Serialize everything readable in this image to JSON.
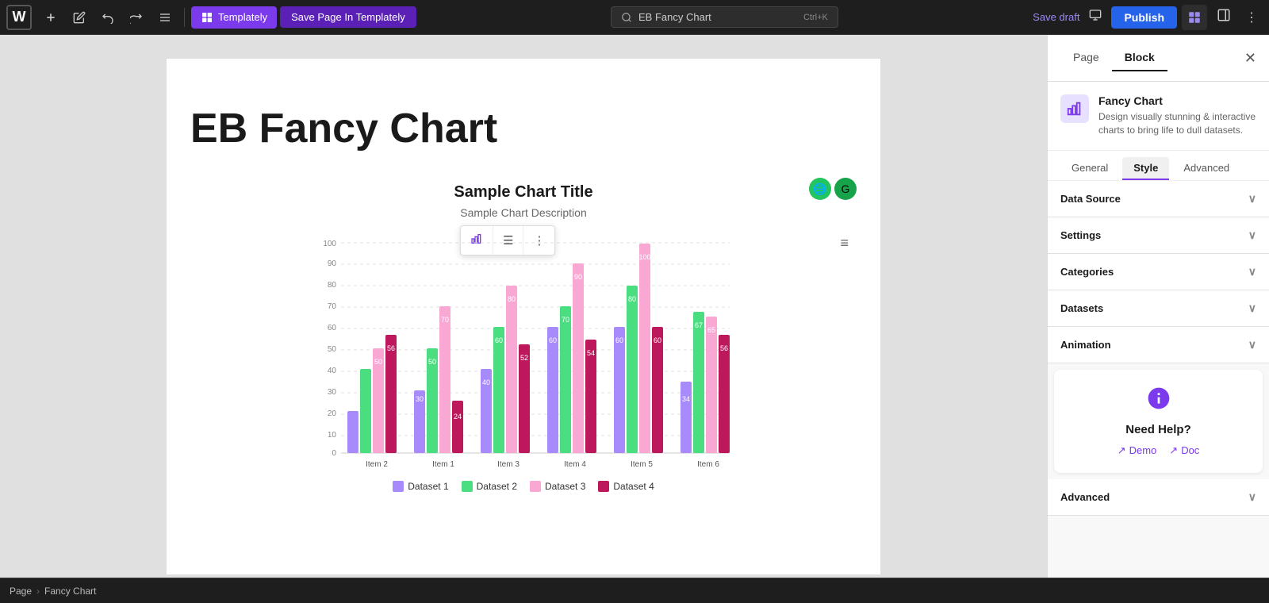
{
  "toolbar": {
    "logo": "W",
    "templately_label": "Templately",
    "save_templately_label": "Save Page In Templately",
    "search_placeholder": "EB Fancy Chart",
    "search_shortcut": "Ctrl+K",
    "save_draft_label": "Save draft",
    "publish_label": "Publish"
  },
  "canvas": {
    "page_title": "EB Fancy Chart",
    "chart_title": "Sample Chart Title",
    "chart_description": "Sample Chart Description",
    "chart_menu_icon": "≡"
  },
  "chart": {
    "y_labels": [
      "0",
      "10",
      "20",
      "30",
      "40",
      "50",
      "60",
      "70",
      "80",
      "90",
      "100"
    ],
    "x_labels": [
      "Item 2",
      "Item 1",
      "Item 3",
      "Item 4",
      "Item 5",
      "Item 6"
    ],
    "datasets": [
      {
        "label": "Dataset 1",
        "color": "#a78bfa"
      },
      {
        "label": "Dataset 2",
        "color": "#4ade80"
      },
      {
        "label": "Dataset 3",
        "color": "#f9a8d4"
      },
      {
        "label": "Dataset 4",
        "color": "#be185d"
      }
    ],
    "bars": [
      {
        "group": "Item 2",
        "values": [
          20,
          40,
          50,
          56
        ]
      },
      {
        "group": "Item 1",
        "values": [
          30,
          50,
          70,
          25
        ]
      },
      {
        "group": "Item 3",
        "values": [
          40,
          60,
          80,
          52
        ]
      },
      {
        "group": "Item 4",
        "values": [
          60,
          70,
          90,
          54
        ]
      },
      {
        "group": "Item 5",
        "values": [
          60,
          80,
          100,
          60
        ]
      },
      {
        "group": "Item 6",
        "values": [
          34,
          67,
          65,
          56
        ]
      }
    ]
  },
  "right_panel": {
    "tab_page": "Page",
    "tab_block": "Block",
    "close_icon": "✕",
    "plugin": {
      "name": "Fancy Chart",
      "description": "Design visually stunning & interactive charts to bring life to dull datasets."
    },
    "sub_tabs": [
      "General",
      "Style",
      "Advanced"
    ],
    "active_sub_tab": "Style",
    "sections": [
      {
        "label": "Data Source"
      },
      {
        "label": "Settings"
      },
      {
        "label": "Categories"
      },
      {
        "label": "Datasets"
      },
      {
        "label": "Animation"
      }
    ],
    "need_help_title": "Need Help?",
    "demo_label": "Demo",
    "doc_label": "Doc",
    "advanced_label": "Advanced"
  },
  "breadcrumb": {
    "items": [
      "Page",
      "Fancy Chart"
    ]
  }
}
